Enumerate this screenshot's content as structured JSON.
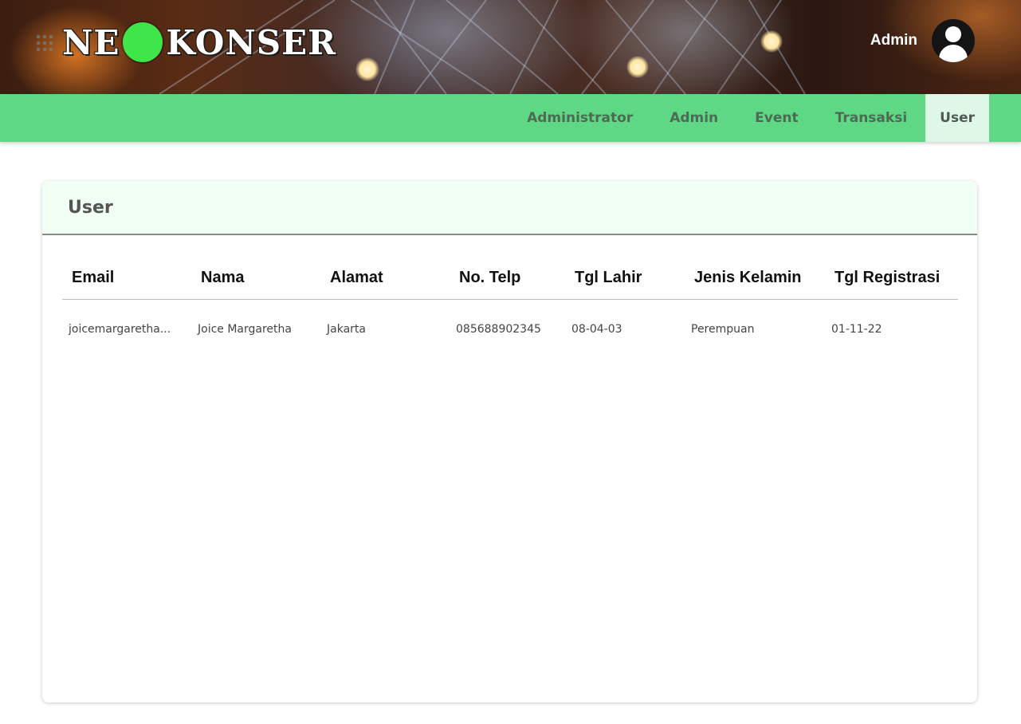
{
  "brand": {
    "logo_left": "NE",
    "logo_right": "KONSER",
    "logo_accent_color": "#3ee64a"
  },
  "header": {
    "user_label": "Admin",
    "avatar_icon": "user-avatar-icon"
  },
  "nav": {
    "bar_color": "#5fd886",
    "items": [
      {
        "label": "Administrator",
        "active": false
      },
      {
        "label": "Admin",
        "active": false
      },
      {
        "label": "Event",
        "active": false
      },
      {
        "label": "Transaksi",
        "active": false
      },
      {
        "label": "User",
        "active": true
      }
    ]
  },
  "card": {
    "title": "User"
  },
  "table": {
    "columns": [
      "Email",
      "Nama",
      "Alamat",
      "No. Telp",
      "Tgl Lahir",
      "Jenis Kelamin",
      "Tgl Registrasi"
    ],
    "rows": [
      {
        "email": "joicemargaretha...",
        "nama": "Joice Margaretha",
        "alamat": "Jakarta",
        "telp": "085688902345",
        "tgl_lahir": "08-04-03",
        "jenis_kelamin": "Perempuan",
        "tgl_registrasi": "01-11-22"
      }
    ]
  }
}
